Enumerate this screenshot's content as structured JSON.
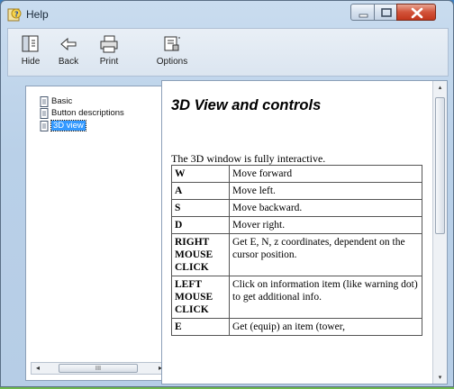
{
  "window": {
    "title": "Help"
  },
  "caption_buttons": [
    "minimize",
    "maximize",
    "close"
  ],
  "toolbar": {
    "hide_label": "Hide",
    "back_label": "Back",
    "print_label": "Print",
    "options_label": "Options"
  },
  "tree": {
    "items": [
      {
        "label": "Basic",
        "selected": false
      },
      {
        "label": "Button descriptions",
        "selected": false
      },
      {
        "label": "3D view",
        "selected": true
      }
    ],
    "scroll_thumb_label": "III"
  },
  "content": {
    "heading": "3D View and controls",
    "intro": "The 3D window is fully interactive.",
    "rows": [
      {
        "key": "W",
        "desc": "Move forward"
      },
      {
        "key": "A",
        "desc": "Move left."
      },
      {
        "key": "S",
        "desc": "Move backward."
      },
      {
        "key": "D",
        "desc": "Mover right."
      },
      {
        "key": "RIGHT MOUSE CLICK",
        "desc": "Get E, N, z coordinates, dependent on the cursor position."
      },
      {
        "key": "LEFT MOUSE CLICK",
        "desc": "Click on information item (like warning dot) to get additional info."
      },
      {
        "key": "E",
        "desc": "Get (equip) an item (tower,"
      }
    ]
  },
  "colors": {
    "selection": "#3399ff",
    "close_button": "#c8432a",
    "frame": "#b9d0e8"
  },
  "icons": [
    "help-icon",
    "hide-icon",
    "back-icon",
    "print-icon",
    "options-icon",
    "document-icon"
  ]
}
